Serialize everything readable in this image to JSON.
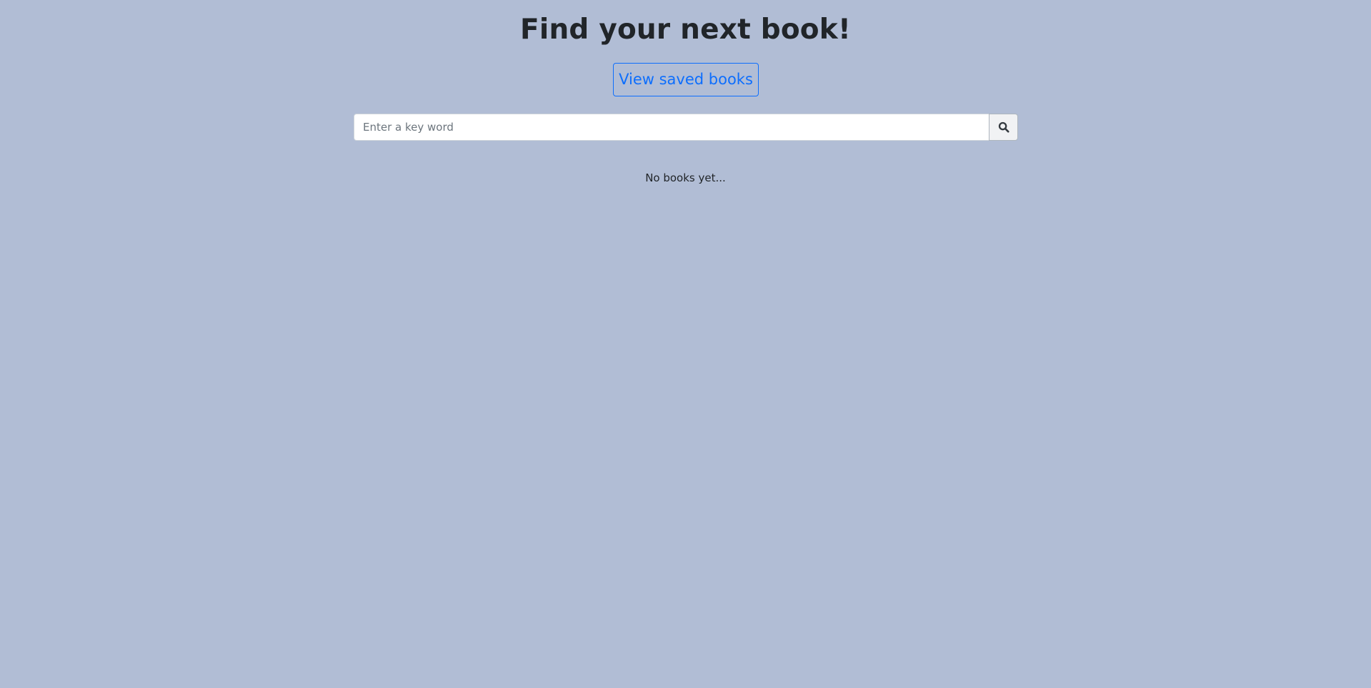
{
  "header": {
    "title": "Find your next book!",
    "saved_books_label": "View saved books"
  },
  "search": {
    "placeholder": "Enter a key word",
    "value": "",
    "button_icon": "search-icon"
  },
  "results": {
    "empty_message": "No books yet..."
  },
  "colors": {
    "background": "#b1bdd5",
    "accent": "#0d6efd",
    "text": "#212529"
  }
}
